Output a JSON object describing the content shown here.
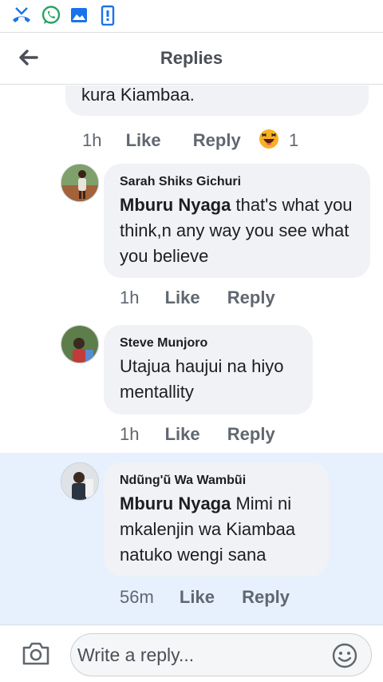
{
  "status_bar": {
    "icons": [
      "missed-call-icon",
      "whatsapp-icon",
      "gallery-icon",
      "phone-update-icon"
    ]
  },
  "header": {
    "title": "Replies"
  },
  "comments": [
    {
      "text": "kura Kiambaa.",
      "time": "1h",
      "like": "Like",
      "reply": "Reply",
      "reaction_icon": "laughing-emoji-icon",
      "reaction_count": "1"
    },
    {
      "author": "Sarah Shiks Gichuri",
      "mention": "Mburu Nyaga",
      "text": " that's what you think,n any way you see  what you believe",
      "time": "1h",
      "like": "Like",
      "reply": "Reply"
    },
    {
      "author": "Steve Munjoro",
      "text": "Utajua haujui na hiyo mentallity",
      "time": "1h",
      "like": "Like",
      "reply": "Reply"
    },
    {
      "author": "Ndũng'ũ Wa Wambũi",
      "mention": "Mburu Nyaga",
      "text": " Mimi ni mkalenjin wa Kiambaa natuko wengi sana",
      "time": "56m",
      "like": "Like",
      "reply": "Reply"
    }
  ],
  "composer": {
    "placeholder": "Write a reply...",
    "camera_icon": "camera-icon",
    "emoji_icon": "smiley-icon"
  },
  "colors": {
    "bubble": "#f0f2f5",
    "highlight": "#e7f0fd",
    "action_text": "#606770",
    "whatsapp": "#25d366",
    "status_blue": "#1a73e8"
  }
}
